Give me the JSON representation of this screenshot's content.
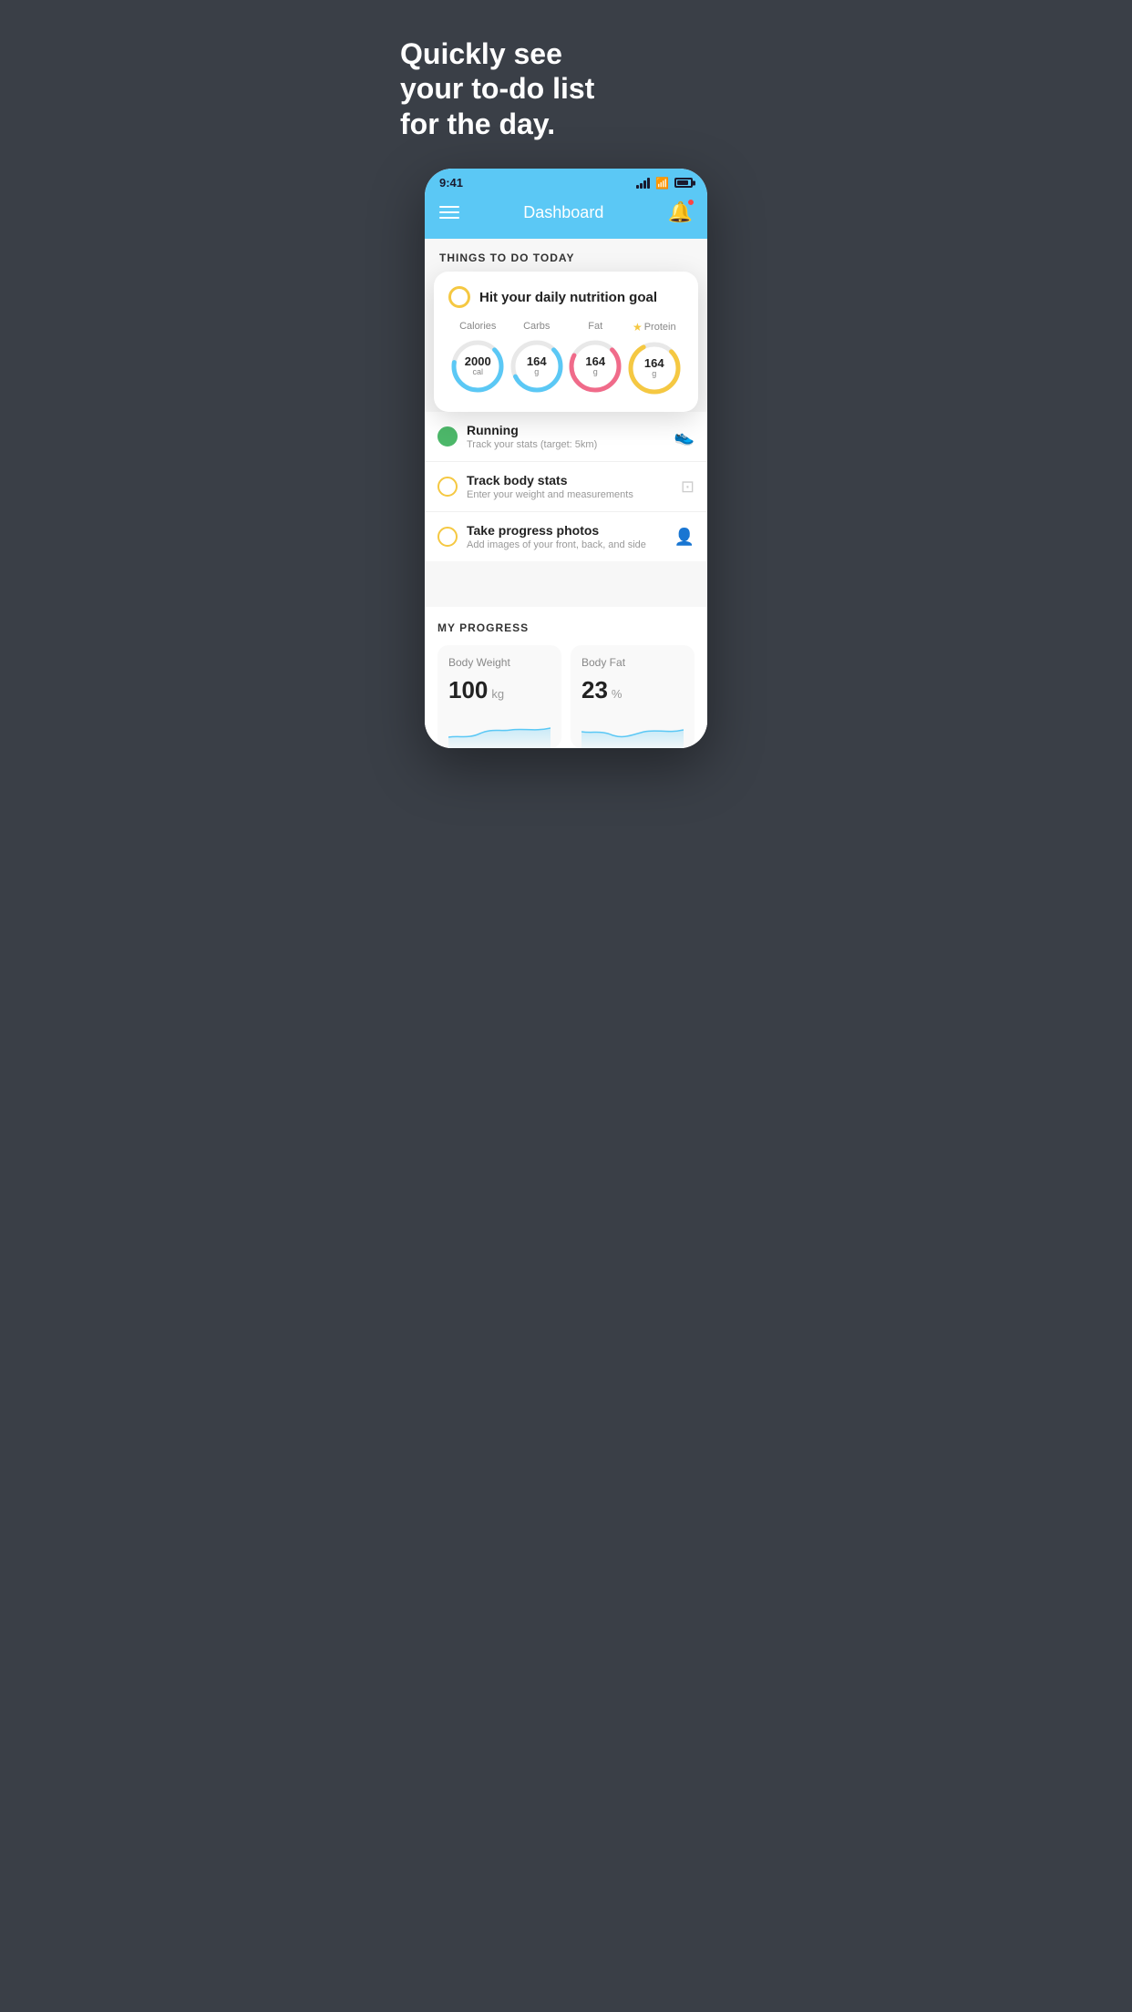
{
  "background_color": "#3a3f47",
  "headline": "Quickly see\nyour to-do list\nfor the day.",
  "phone": {
    "status_bar": {
      "time": "9:41"
    },
    "header": {
      "title": "Dashboard"
    },
    "section_title": "THINGS TO DO TODAY",
    "nutrition_card": {
      "circle_type": "yellow_empty",
      "title": "Hit your daily nutrition goal",
      "items": [
        {
          "label": "Calories",
          "value": "2000",
          "unit": "cal",
          "color": "#5bc8f5",
          "percentage": 65
        },
        {
          "label": "Carbs",
          "value": "164",
          "unit": "g",
          "color": "#5bc8f5",
          "percentage": 55
        },
        {
          "label": "Fat",
          "value": "164",
          "unit": "g",
          "color": "#f06b8a",
          "percentage": 70
        },
        {
          "label": "Protein",
          "value": "164",
          "unit": "g",
          "color": "#f5c842",
          "percentage": 80,
          "starred": true
        }
      ]
    },
    "todo_items": [
      {
        "id": "running",
        "circle_color": "green",
        "title": "Running",
        "subtitle": "Track your stats (target: 5km)",
        "icon": "shoe"
      },
      {
        "id": "body-stats",
        "circle_color": "yellow",
        "title": "Track body stats",
        "subtitle": "Enter your weight and measurements",
        "icon": "scale"
      },
      {
        "id": "progress-photos",
        "circle_color": "yellow",
        "title": "Take progress photos",
        "subtitle": "Add images of your front, back, and side",
        "icon": "person"
      }
    ],
    "progress": {
      "section_title": "MY PROGRESS",
      "cards": [
        {
          "id": "body-weight",
          "title": "Body Weight",
          "value": "100",
          "unit": "kg"
        },
        {
          "id": "body-fat",
          "title": "Body Fat",
          "value": "23",
          "unit": "%"
        }
      ]
    }
  }
}
